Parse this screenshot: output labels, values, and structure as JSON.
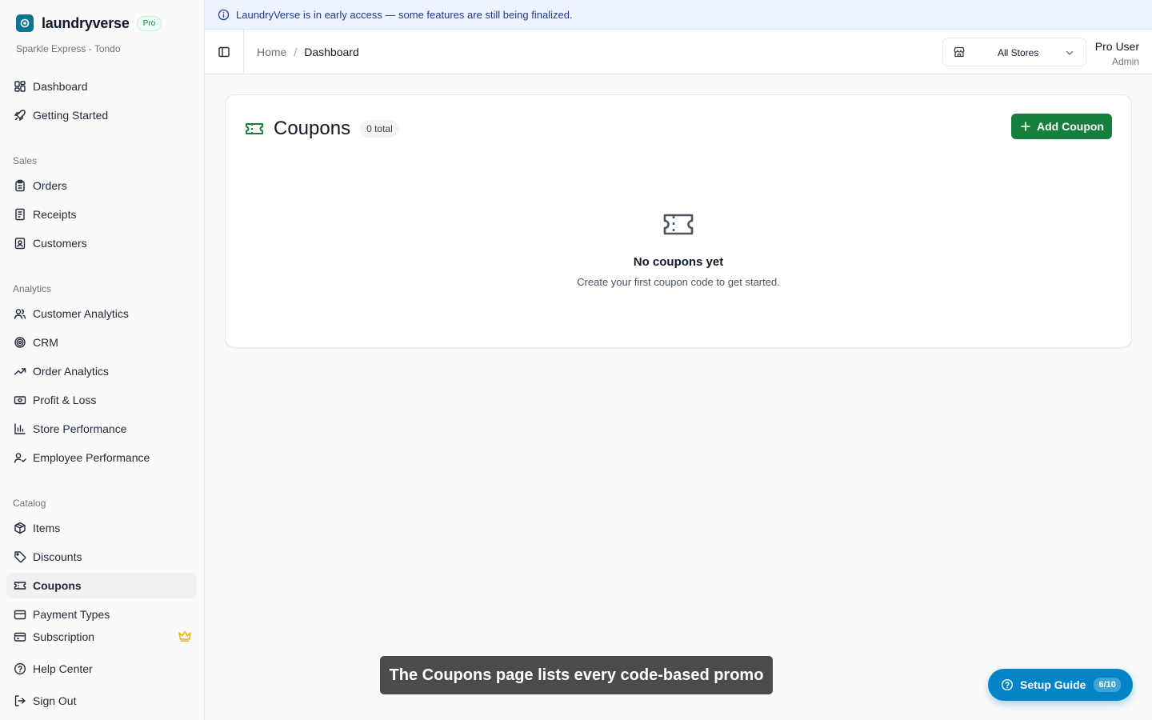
{
  "banner": {
    "text": "LaundryVerse is in early access — some features are still being finalized."
  },
  "brand": {
    "name": "laundryverse",
    "badge": "Pro",
    "subtitle": "Sparkle Express - Tondo"
  },
  "sidebar": {
    "top_items": [
      {
        "label": "Dashboard",
        "icon": "dashboard-icon"
      },
      {
        "label": "Getting Started",
        "icon": "rocket-icon"
      }
    ],
    "sections": [
      {
        "label": "Sales",
        "items": [
          {
            "label": "Orders",
            "icon": "clipboard-icon"
          },
          {
            "label": "Receipts",
            "icon": "receipt-icon"
          },
          {
            "label": "Customers",
            "icon": "contact-icon"
          }
        ]
      },
      {
        "label": "Analytics",
        "items": [
          {
            "label": "Customer Analytics",
            "icon": "users-icon"
          },
          {
            "label": "CRM",
            "icon": "target-icon"
          },
          {
            "label": "Order Analytics",
            "icon": "trend-icon"
          },
          {
            "label": "Profit & Loss",
            "icon": "money-icon"
          },
          {
            "label": "Store Performance",
            "icon": "bar-chart-icon"
          },
          {
            "label": "Employee Performance",
            "icon": "user-check-icon"
          }
        ]
      },
      {
        "label": "Catalog",
        "items": [
          {
            "label": "Items",
            "icon": "package-icon"
          },
          {
            "label": "Discounts",
            "icon": "tag-icon"
          },
          {
            "label": "Coupons",
            "icon": "ticket-icon",
            "active": true
          },
          {
            "label": "Payment Types",
            "icon": "wallet-icon"
          }
        ]
      }
    ],
    "bottom_items": [
      {
        "label": "Subscription",
        "icon": "credit-card-icon"
      },
      {
        "label": "Help Center",
        "icon": "help-circle-icon"
      },
      {
        "label": "Sign Out",
        "icon": "sign-out-icon"
      }
    ]
  },
  "header": {
    "breadcrumb": {
      "home": "Home",
      "separator": "/",
      "current": "Dashboard"
    },
    "store_select": {
      "value": "All Stores"
    },
    "user": {
      "name": "Pro User",
      "role": "Admin"
    }
  },
  "coupons": {
    "title": "Coupons",
    "count_label": "0 total",
    "add_button": "Add Coupon",
    "empty_title": "No coupons yet",
    "empty_description": "Create your first coupon code to get started."
  },
  "caption": "The Coupons page lists every code-based promo",
  "setup_guide": {
    "label": "Setup Guide",
    "progress": "6/10"
  },
  "colors": {
    "accent_green": "#15803d",
    "setup_blue": "#0284c7",
    "banner_bg": "#eef4ff",
    "crown_gold": "#eab308"
  }
}
